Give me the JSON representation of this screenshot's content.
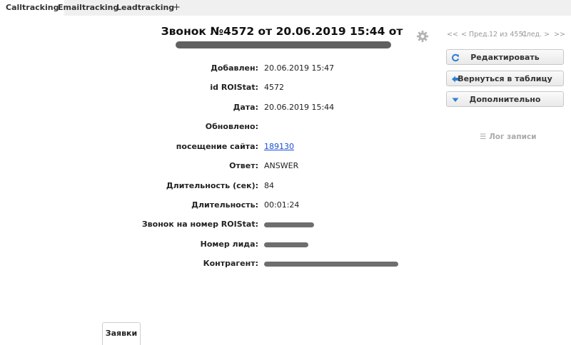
{
  "tabs": [
    {
      "label": "Calltracking"
    },
    {
      "label": "Emailtracking"
    },
    {
      "label": "Leadtracking"
    },
    {
      "label": "+"
    }
  ],
  "header": {
    "title": "Звонок №4572 от 20.06.2019 15:44 от"
  },
  "icons": {
    "gear": "gear-icon",
    "edit": "refresh-icon",
    "back": "arrow-left-icon",
    "more": "triangle-down-icon",
    "log": "list-icon"
  },
  "pager": {
    "first": "<<",
    "prev": "< Пред.",
    "position": "12 из 4551",
    "next": "След. >",
    "last": ">>"
  },
  "actions": {
    "edit": "Редактировать",
    "back": "Вернуться в таблицу",
    "more": "Дополнительно",
    "log": "Лог записи"
  },
  "details": [
    {
      "label": "Добавлен:",
      "value": "20.06.2019 15:47"
    },
    {
      "label": "id ROIStat:",
      "value": "4572"
    },
    {
      "label": "Дата:",
      "value": "20.06.2019 15:44"
    },
    {
      "label": "Обновлено:",
      "value": ""
    },
    {
      "label": "посещение сайта:",
      "value": "189130"
    },
    {
      "label": "Ответ:",
      "value": "ANSWER"
    },
    {
      "label": "Длительность (сек):",
      "value": "84"
    },
    {
      "label": "Длительность:",
      "value": "00:01:24"
    },
    {
      "label": "Звонок на номер ROIStat:",
      "value": ""
    },
    {
      "label": "Номер лида:",
      "value": ""
    },
    {
      "label": "Контрагент:",
      "value": ""
    }
  ],
  "bottom_tab": {
    "label": "Заявки"
  },
  "colors": {
    "link": "#1a4fd6",
    "redaction": "#555555",
    "tabbar": "#f0f0f0"
  }
}
